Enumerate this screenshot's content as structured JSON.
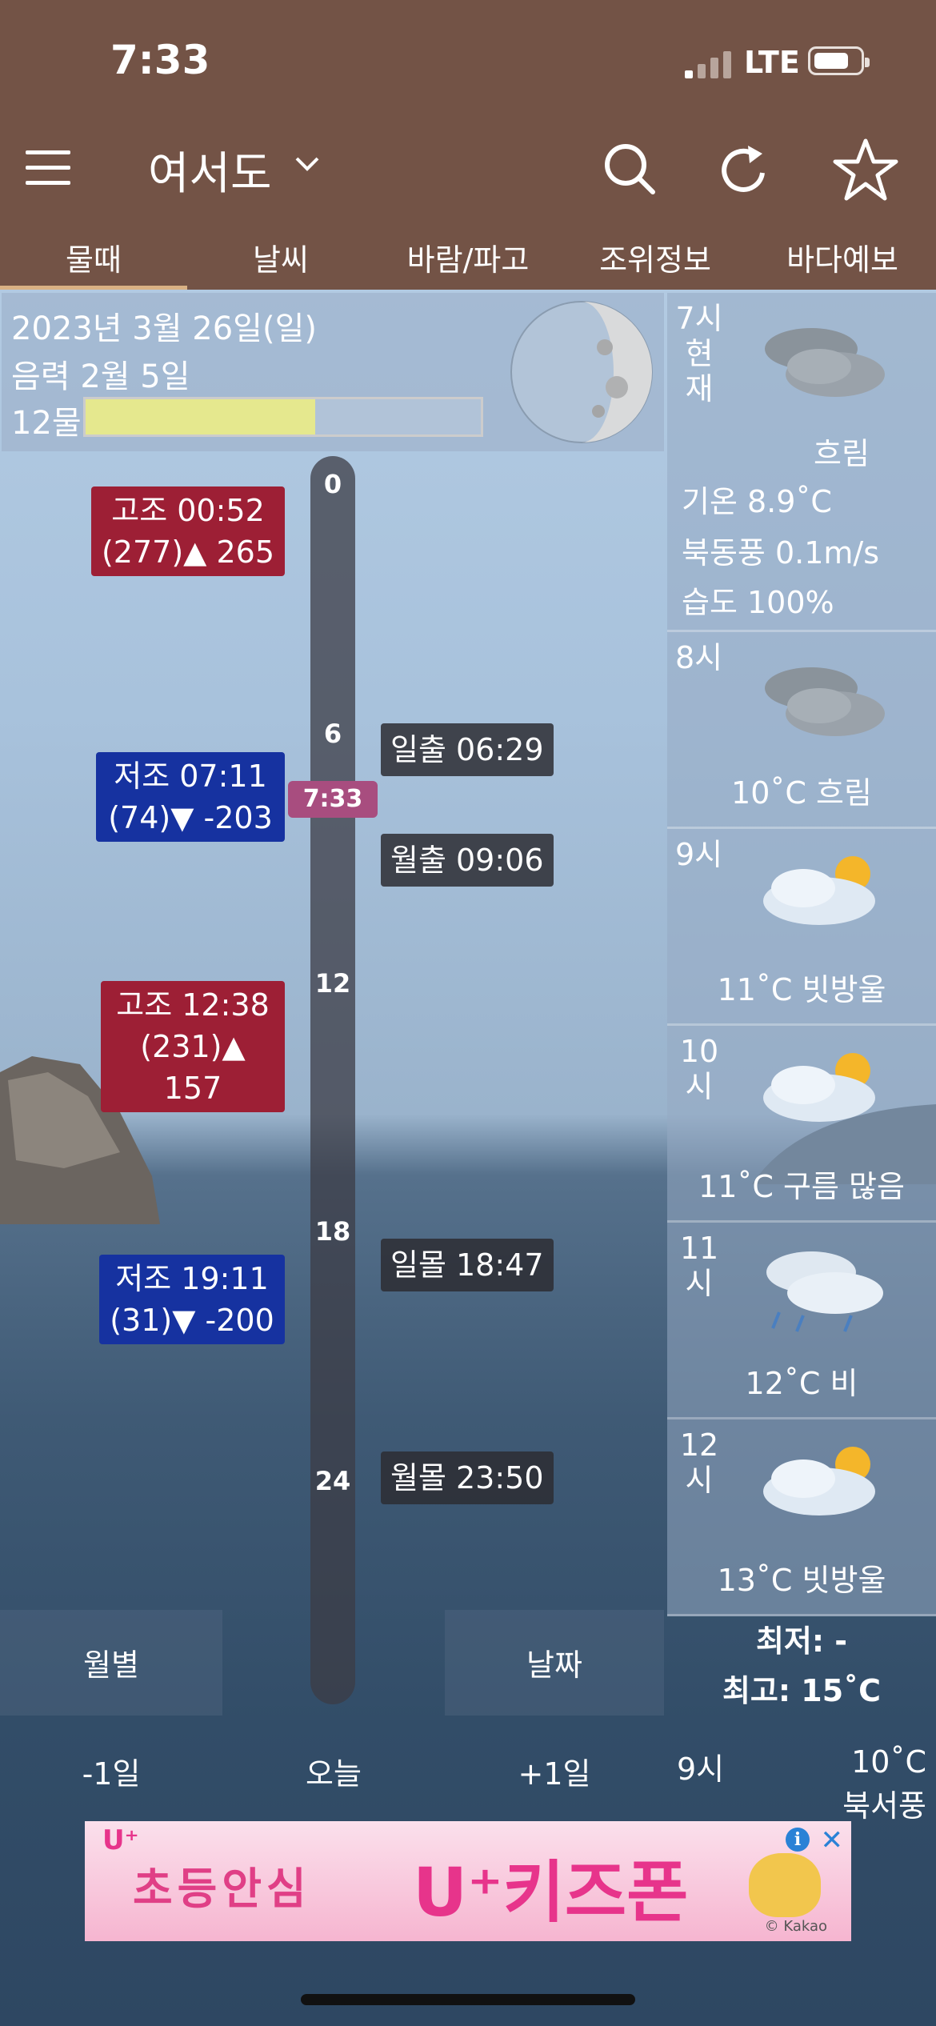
{
  "status": {
    "time": "7:33",
    "network": "LTE"
  },
  "header": {
    "location": "여서도"
  },
  "tabs": [
    "물때",
    "날씨",
    "바람/파고",
    "조위정보",
    "바다예보"
  ],
  "info": {
    "date": "2023년 3월 26일(일)",
    "lunar": "음력 2월 5일",
    "mul": "12물",
    "mul_level": 0.58
  },
  "timeline": {
    "ticks": [
      "0",
      "6",
      "12",
      "18",
      "24"
    ],
    "now": "7:33"
  },
  "tides": [
    {
      "type": "high",
      "line1": "고조 00:52",
      "line2": "(277)▲ 265"
    },
    {
      "type": "low",
      "line1": "저조 07:11",
      "line2": "(74)▼ -203"
    },
    {
      "type": "high",
      "line1": "고조 12:38",
      "line2": "(231)▲ 157"
    },
    {
      "type": "low",
      "line1": "저조 19:11",
      "line2": "(31)▼ -200"
    }
  ],
  "events": [
    "일출 06:29",
    "월출 09:06",
    "일몰 18:47",
    "월몰 23:50"
  ],
  "weather_now": {
    "hour": "7시\n현\n재",
    "desc": "흐림",
    "temp": "기온 8.9˚C",
    "wind": "북동풍 0.1m/s",
    "humidity": "습도 100%"
  },
  "weather_hours": [
    {
      "hour": "8시",
      "desc": "10˚C 흐림",
      "icon": "cloudy"
    },
    {
      "hour": "9시",
      "desc": "11˚C 빗방울",
      "icon": "partly-sunny"
    },
    {
      "hour": "10\n시",
      "desc": "11˚C 구름 많음",
      "icon": "partly-sunny"
    },
    {
      "hour": "11\n시",
      "desc": "12˚C 비",
      "icon": "rain"
    },
    {
      "hour": "12\n시",
      "desc": "13˚C 빗방울",
      "icon": "partly-sunny"
    }
  ],
  "minmax": {
    "min": "최저: -",
    "max": "최고: 15˚C"
  },
  "bottom_weather": {
    "hour": "9시",
    "temp": "10˚C",
    "wind": "북서풍"
  },
  "nav": {
    "monthly": "월별",
    "date": "날짜",
    "prev": "-1일",
    "today": "오늘",
    "next": "+1일"
  },
  "ad": {
    "uplus": "U⁺",
    "text": "초등안심",
    "brand": "U⁺키즈폰",
    "credit": "© Kakao"
  }
}
